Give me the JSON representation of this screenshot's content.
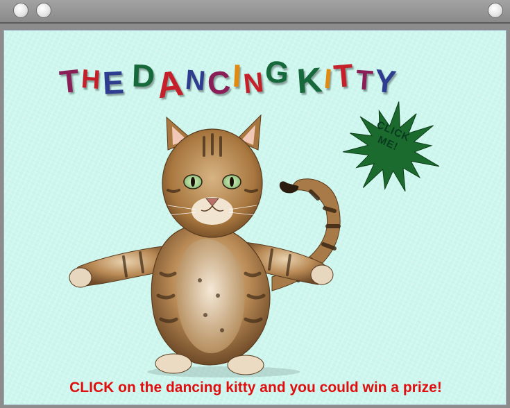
{
  "window": {
    "buttons": [
      "close",
      "minimize",
      "zoom"
    ]
  },
  "title": {
    "letters": [
      {
        "ch": "T",
        "color": "#8a1f57"
      },
      {
        "ch": "H",
        "color": "#c51f2a"
      },
      {
        "ch": "E",
        "color": "#2e3d8f"
      },
      {
        "ch": " ",
        "color": "#000000"
      },
      {
        "ch": "D",
        "color": "#16693a"
      },
      {
        "ch": "A",
        "color": "#c51f2a"
      },
      {
        "ch": "N",
        "color": "#2e3d8f"
      },
      {
        "ch": "C",
        "color": "#8a1f57"
      },
      {
        "ch": "I",
        "color": "#e08a12"
      },
      {
        "ch": "N",
        "color": "#c51f2a"
      },
      {
        "ch": "G",
        "color": "#16693a"
      },
      {
        "ch": " ",
        "color": "#000000"
      },
      {
        "ch": "K",
        "color": "#16693a"
      },
      {
        "ch": "I",
        "color": "#e08a12"
      },
      {
        "ch": "T",
        "color": "#c51f2a"
      },
      {
        "ch": "T",
        "color": "#8a1f57"
      },
      {
        "ch": "Y",
        "color": "#2e3d8f"
      }
    ]
  },
  "starburst": {
    "label_line1": "CLICK",
    "label_line2": "ME!",
    "color": "#1c6b2e"
  },
  "caption": "CLICK on the dancing kitty and you could win a prize!",
  "colors": {
    "background": "#cdf7ee",
    "caption": "#e00f0f"
  }
}
